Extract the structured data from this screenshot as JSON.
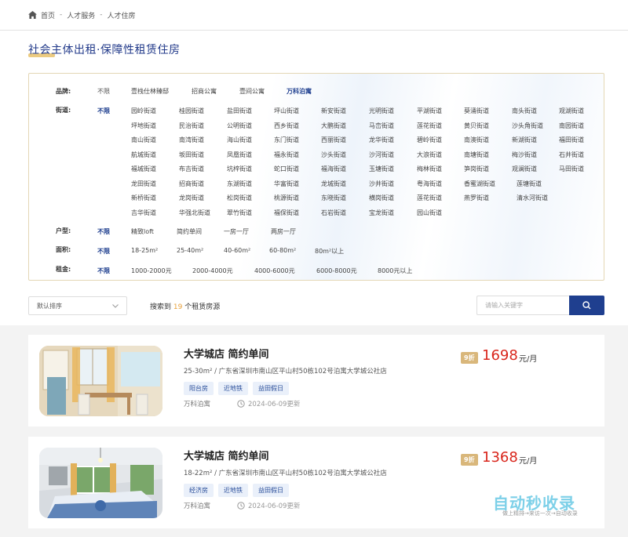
{
  "breadcrumb": [
    "首页",
    "人才服务",
    "人才住房"
  ],
  "page_title": "社会主体出租·保障性租赁住房",
  "filters": {
    "brand": {
      "label": "品牌:",
      "all": "不限",
      "options": [
        "壹栈仕林臻邸",
        "招商公寓",
        "壹间公寓",
        "万科泊寓"
      ]
    },
    "street": {
      "label": "街道:",
      "all": "不限",
      "options": [
        "园岭街道",
        "桂园街道",
        "盐田街道",
        "坪山街道",
        "新安街道",
        "光明街道",
        "平湖街道",
        "葵涌街道",
        "南头街道",
        "观湖街道",
        "坪地街道",
        "民治街道",
        "公明街道",
        "西乡街道",
        "大鹏街道",
        "马峦街道",
        "莲花街道",
        "黄贝街道",
        "沙头角街道",
        "南园街道",
        "南山街道",
        "南湾街道",
        "海山街道",
        "东门街道",
        "西丽街道",
        "龙华街道",
        "碧岭街道",
        "南澳街道",
        "新湖街道",
        "福田街道",
        "航城街道",
        "坂田街道",
        "凤凰街道",
        "福永街道",
        "沙头街道",
        "沙河街道",
        "大浪街道",
        "南塘街道",
        "梅沙街道",
        "石井街道",
        "福城街道",
        "布吉街道",
        "坑梓街道",
        "蛇口街道",
        "福海街道",
        "玉塘街道",
        "梅林街道",
        "笋岗街道",
        "观澜街道",
        "马田街道",
        "龙田街道",
        "招商街道",
        "东湖街道",
        "华富街道",
        "龙城街道",
        "沙井街道",
        "粤海街道",
        "香蜜湖街道",
        "莲塘街道",
        "新桥街道",
        "龙岗街道",
        "松岗街道",
        "桃源街道",
        "东晓街道",
        "横岗街道",
        "莲花街道",
        "燕罗街道",
        "清水河街道",
        "吉华街道",
        "华强北街道",
        "翠竹街道",
        "福保街道",
        "石岩街道",
        "宝龙街道",
        "园山街道"
      ]
    },
    "room_type": {
      "label": "户型:",
      "all": "不限",
      "options": [
        "精致loft",
        "简约单间",
        "一房一厅",
        "两房一厅"
      ]
    },
    "area": {
      "label": "面积:",
      "all": "不限",
      "options": [
        "18-25m²",
        "25-40m²",
        "40-60m²",
        "60-80m²",
        "80m²以上"
      ]
    },
    "rent": {
      "label": "租金:",
      "all": "不限",
      "options": [
        "1000-2000元",
        "2000-4000元",
        "4000-6000元",
        "6000-8000元",
        "8000元以上"
      ]
    }
  },
  "toolbar": {
    "sort_label": "默认排序",
    "result_prefix": "搜索到",
    "result_count": "19",
    "result_suffix": "个租赁房源",
    "search_placeholder": "请输入关键字"
  },
  "listings": [
    {
      "title": "大学城店 简约单间",
      "area": "25-30m²",
      "address": "广东省深圳市南山区平山村50栋102号泊寓大学城公社店",
      "tags": [
        "阳台房",
        "近地铁",
        "益田假日"
      ],
      "brand": "万科泊寓",
      "updated": "2024-06-09更新",
      "discount": "9折",
      "price": "1698",
      "unit": "元/月"
    },
    {
      "title": "大学城店 简约单间",
      "area": "18-22m²",
      "address": "广东省深圳市南山区平山村50栋102号泊寓大学城公社店",
      "tags": [
        "经济房",
        "近地铁",
        "益田假日"
      ],
      "brand": "万科泊寓",
      "updated": "2024-06-09更新",
      "discount": "9折",
      "price": "1368",
      "unit": "元/月"
    }
  ],
  "watermark": {
    "logo": "自动秒收录",
    "sub": "做上精排→来访一次→自动收录"
  },
  "colors": {
    "accent": "#1f3f8f",
    "price": "#d9261c",
    "gold": "#e9c26b"
  }
}
